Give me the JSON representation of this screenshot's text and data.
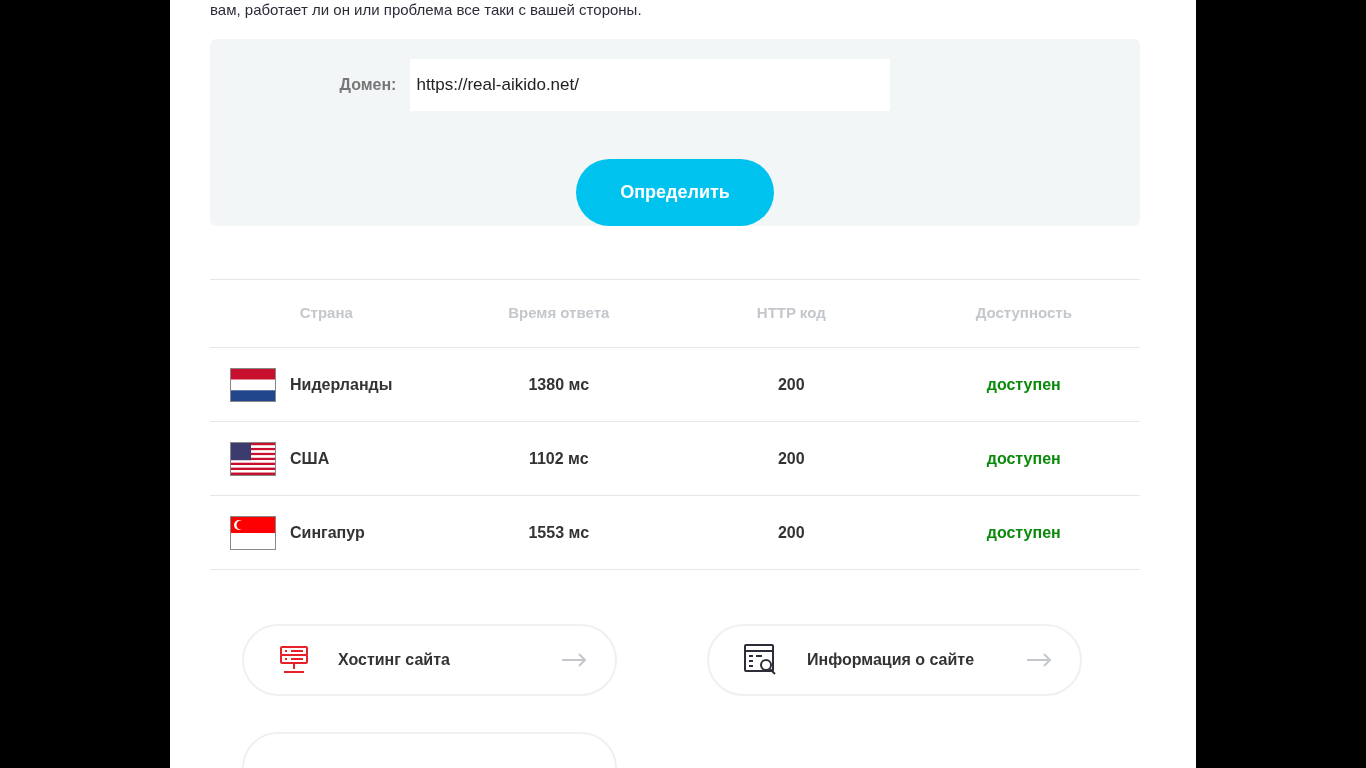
{
  "intro_text": "вам, работает ли он или проблема все таки с вашей стороны.",
  "form": {
    "label": "Домен:",
    "value": "https://real-aikido.net/",
    "button": "Определить"
  },
  "table": {
    "columns": [
      "Страна",
      "Время ответа",
      "HTTP код",
      "Доступность"
    ],
    "rows": [
      {
        "kind": "netherlands",
        "country": "Нидерланды",
        "time": "1380 мс",
        "code": "200",
        "status": "доступен",
        "color": "#0a8a0a"
      },
      {
        "kind": "usa",
        "country": "США",
        "time": "1102 мс",
        "code": "200",
        "status": "доступен",
        "color": "#0a8a0a"
      },
      {
        "kind": "singapore",
        "country": "Сингапур",
        "time": "1553 мс",
        "code": "200",
        "status": "доступен",
        "color": "#0a8a0a"
      }
    ]
  },
  "links": [
    {
      "kind": "server",
      "label": "Хостинг сайта"
    },
    {
      "kind": "info",
      "label": "Информация о сайте"
    }
  ]
}
